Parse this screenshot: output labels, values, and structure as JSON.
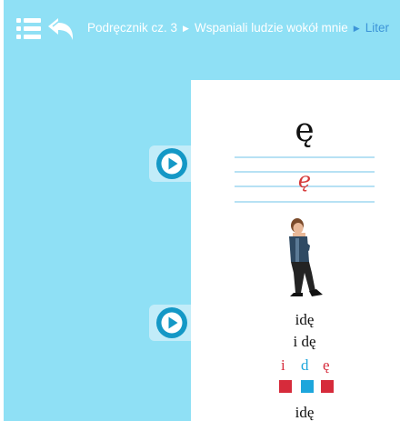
{
  "header": {
    "breadcrumb": [
      {
        "label": "Podręcznik cz. 3"
      },
      {
        "label": "Wspaniali ludzie wokół mnie"
      },
      {
        "label": "Liter"
      }
    ]
  },
  "icons": {
    "menu": "list-menu-icon",
    "back": "back-arrow-icon",
    "play": "play-icon"
  },
  "colors": {
    "background": "#8fe0f5",
    "play_button": "#1498c6",
    "vowel": "#d62b3b",
    "consonant": "#1da6dc"
  },
  "lesson": {
    "letter": "ę",
    "script_letter": "ę",
    "words": [
      "idę",
      "i dę",
      "idę"
    ],
    "syllables": [
      {
        "text": "i",
        "color": "#d62b3b"
      },
      {
        "text": "d",
        "color": "#1da6dc"
      },
      {
        "text": "ę",
        "color": "#d62b3b"
      }
    ]
  }
}
